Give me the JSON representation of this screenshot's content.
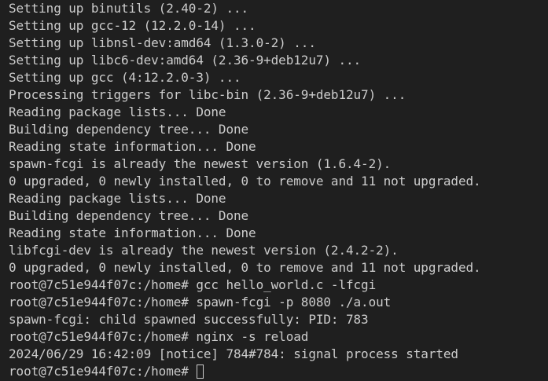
{
  "terminal": {
    "lines": [
      "Setting up binutils (2.40-2) ...",
      "Setting up gcc-12 (12.2.0-14) ...",
      "Setting up libnsl-dev:amd64 (1.3.0-2) ...",
      "Setting up libc6-dev:amd64 (2.36-9+deb12u7) ...",
      "Setting up gcc (4:12.2.0-3) ...",
      "Processing triggers for libc-bin (2.36-9+deb12u7) ...",
      "Reading package lists... Done",
      "Building dependency tree... Done",
      "Reading state information... Done",
      "spawn-fcgi is already the newest version (1.6.4-2).",
      "0 upgraded, 0 newly installed, 0 to remove and 11 not upgraded.",
      "Reading package lists... Done",
      "Building dependency tree... Done",
      "Reading state information... Done",
      "libfcgi-dev is already the newest version (2.4.2-2).",
      "0 upgraded, 0 newly installed, 0 to remove and 11 not upgraded.",
      "root@7c51e944f07c:/home# gcc hello_world.c -lfcgi",
      "root@7c51e944f07c:/home# spawn-fcgi -p 8080 ./a.out",
      "spawn-fcgi: child spawned successfully: PID: 783",
      "root@7c51e944f07c:/home# nginx -s reload",
      "2024/06/29 16:42:09 [notice] 784#784: signal process started"
    ],
    "prompt": "root@7c51e944f07c:/home# ",
    "text_color": "#cccccc",
    "background_color": "#1f1f1f"
  }
}
